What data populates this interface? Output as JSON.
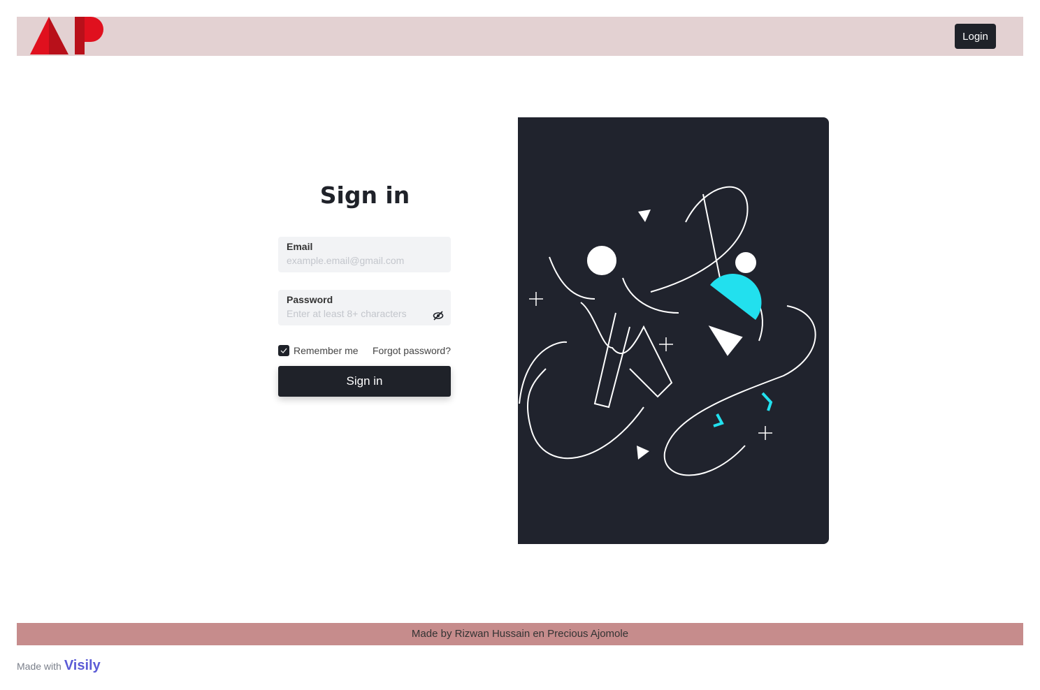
{
  "header": {
    "logo_text": "AP",
    "login_label": "Login"
  },
  "form": {
    "title": "Sign in",
    "email": {
      "label": "Email",
      "placeholder": "example.email@gmail.com",
      "value": ""
    },
    "password": {
      "label": "Password",
      "placeholder": "Enter at least 8+ characters",
      "value": ""
    },
    "remember_label": "Remember me",
    "remember_checked": true,
    "forgot_label": "Forgot password?",
    "submit_label": "Sign in"
  },
  "footer": {
    "text": "Made by Rizwan Hussain en Precious Ajomole"
  },
  "badge": {
    "prefix": "Made with",
    "brand": "Visily"
  },
  "colors": {
    "header": "#e3d1d2",
    "footer": "#c68c8c",
    "primary": "#1f2229",
    "logo_red": "#e0101e",
    "accent": "#22e0ee"
  }
}
